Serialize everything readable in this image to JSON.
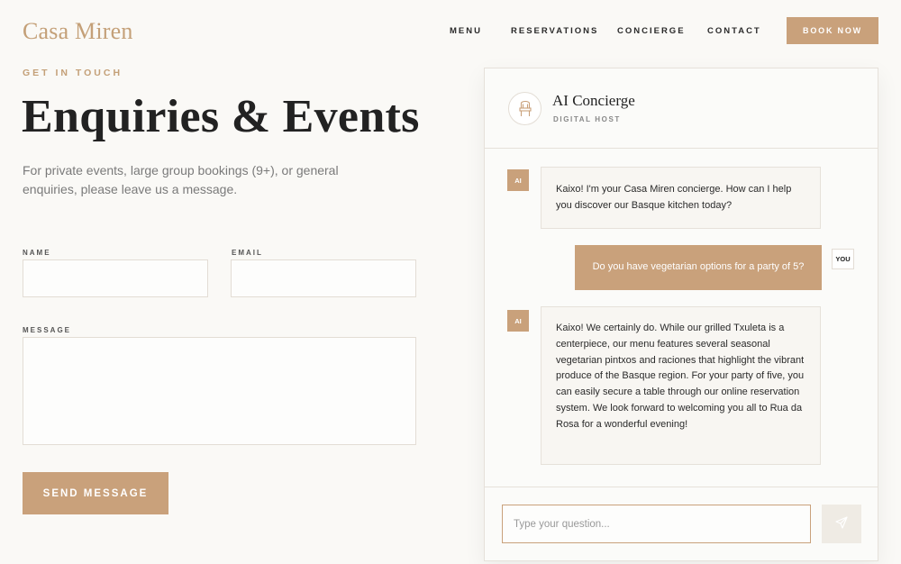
{
  "header": {
    "logo": "Casa Miren",
    "nav": [
      {
        "label": "MENU"
      },
      {
        "label": "RESERVATIONS"
      },
      {
        "label": "CONCIERGE"
      },
      {
        "label": "CONTACT"
      }
    ],
    "book_label": "BOOK NOW"
  },
  "main": {
    "eyebrow": "GET IN TOUCH",
    "title": "Enquiries & Events",
    "intro": "For private events, large group bookings (9+), or general enquiries, please leave us a message.",
    "form": {
      "name_label": "NAME",
      "name_value": "",
      "email_label": "EMAIL",
      "email_value": "",
      "message_label": "MESSAGE",
      "message_value": "",
      "send_label": "SEND MESSAGE"
    }
  },
  "chat": {
    "title": "AI Concierge",
    "subtitle": "DIGITAL HOST",
    "messages": [
      {
        "sender": "AI",
        "text": "Kaixo! I'm your Casa Miren concierge. How can I help you discover our Basque kitchen today?"
      },
      {
        "sender": "YOU",
        "text": "Do you have vegetarian options for a party of 5?"
      },
      {
        "sender": "AI",
        "text": "Kaixo! We certainly do. While our grilled Txuleta is a centerpiece, our menu features several seasonal vegetarian pintxos and raciones that highlight the vibrant produce of the Basque region. For your party of five, you can easily secure a table through our online reservation system. We look forward to welcoming you all to Rua da Rosa for a wonderful evening!"
      }
    ],
    "input_value": "",
    "input_placeholder": "Type your question...",
    "icons": {
      "avatar": "chair-icon",
      "send": "send-icon"
    }
  },
  "colors": {
    "accent": "#c9a17b",
    "background": "#faf9f6",
    "text": "#222222"
  }
}
